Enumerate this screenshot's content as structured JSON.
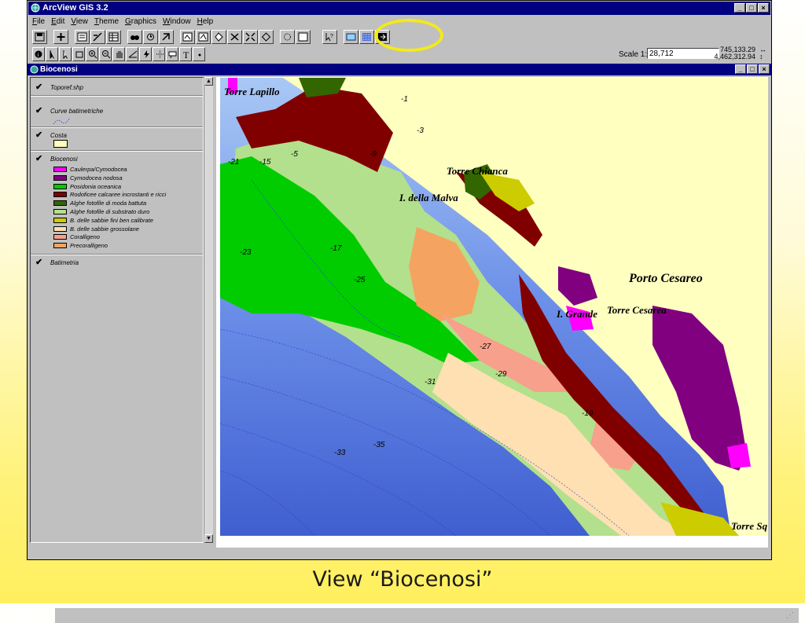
{
  "app": {
    "title": "ArcView GIS 3.2"
  },
  "menu": [
    "File",
    "Edit",
    "View",
    "Theme",
    "Graphics",
    "Window",
    "Help"
  ],
  "toolbar": {
    "buttons": [
      "save-icon",
      "add-theme-icon",
      "theme-properties-icon",
      "edit-legend-icon",
      "open-table-icon",
      "find-icon",
      "query-builder-icon",
      "select-by-theme-icon",
      "zoom-full-icon",
      "zoom-active-icon",
      "zoom-selected-icon",
      "zoom-in-icon",
      "zoom-out-icon",
      "select-features-icon",
      "clear-selection-icon",
      "help-icon",
      "custom-tool-a-icon",
      "custom-tool-b-icon",
      "custom-tool-c-icon"
    ],
    "scale_label": "Scale 1:",
    "scale_value": "28,712",
    "coord_x": "745,133.29",
    "coord_y": "4,462,312.94"
  },
  "tools": [
    "identify-tool-icon",
    "pointer-tool-icon",
    "vertex-tool-icon",
    "zoom-tool-icon",
    "zoom-in-tool-icon",
    "zoom-out-tool-icon",
    "pan-tool-icon",
    "measure-tool-icon",
    "hotlink-tool-icon",
    "label-tool-icon",
    "text-label-tool-icon",
    "text-tool-icon",
    "draw-point-tool-icon"
  ],
  "view": {
    "title": "Biocenosi",
    "themes": {
      "toporef": "Toporef.shp",
      "curve": "Curve batimetriche",
      "costa": "Costa",
      "biocenosi": "Biocenosi",
      "batimetria": "Batimetria"
    },
    "legend": [
      {
        "label": "Caulerpa/Cymodocea",
        "color": "#ff00ff"
      },
      {
        "label": "Cymodocea nodosa",
        "color": "#800080"
      },
      {
        "label": "Posidonia oceanica",
        "color": "#00cc00"
      },
      {
        "label": "Rodoficee calcaree incrostanti e ricci",
        "color": "#800000"
      },
      {
        "label": "Alghe fotofile di moda battuta",
        "color": "#336600"
      },
      {
        "label": "Alghe fotofile di substrato duro",
        "color": "#b3e08c"
      },
      {
        "label": "B. delle sabbie fini ben calibrate",
        "color": "#cccc00"
      },
      {
        "label": "B. delle sabbie grossolane",
        "color": "#ffe0b3"
      },
      {
        "label": "Coralligeno",
        "color": "#f7a08c"
      },
      {
        "label": "Precoralligeno",
        "color": "#f4a460"
      }
    ],
    "costa_color": "#ffffc0"
  },
  "map": {
    "place_labels": [
      "Torre Lapillo",
      "Torre Chianca",
      "I. della Malva",
      "Porto Cesareo",
      "I. Grande",
      "Torre Cesarea",
      "Torre Sq"
    ],
    "depth_labels": [
      "-1",
      "-3",
      "-5",
      "-9",
      "-15",
      "-17",
      "-21",
      "-23",
      "-25",
      "-27",
      "-29",
      "-31",
      "-33",
      "-35",
      "-19"
    ]
  },
  "caption": "View “Biocenosi”"
}
